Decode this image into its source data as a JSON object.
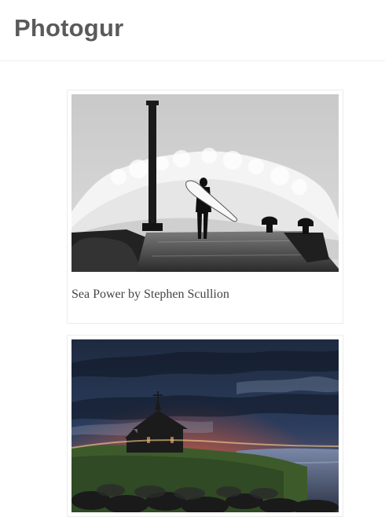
{
  "app": {
    "brand": "Photogur"
  },
  "photos": [
    {
      "caption": "Sea Power by Stephen Scullion",
      "subject": "surfer-on-pier-wave-photo"
    },
    {
      "caption": "",
      "subject": "church-sunset-photo"
    }
  ],
  "colors": {
    "header_border": "#ececec",
    "brand_text": "#5a5a5a",
    "card_border": "#ececec"
  }
}
